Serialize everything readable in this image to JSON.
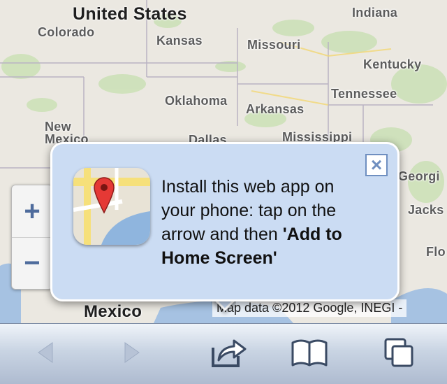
{
  "map": {
    "labels": {
      "united_states": "United States",
      "colorado": "Colorado",
      "kansas": "Kansas",
      "missouri": "Missouri",
      "indiana": "Indiana",
      "kentucky": "Kentucky",
      "tennessee": "Tennessee",
      "oklahoma": "Oklahoma",
      "arkansas": "Arkansas",
      "new_mexico": "New\nMexico",
      "dallas": "Dallas",
      "mississippi": "Mississippi",
      "georgia": "Georgi",
      "jacks": "Jacks",
      "flo": "Flo",
      "mexico": "Mexico"
    },
    "attribution": "Map data ©2012 Google, INEGI -",
    "zoom": {
      "in_label": "+",
      "out_label": "−"
    }
  },
  "popup": {
    "text_plain": "Install this web app on your phone: tap on the arrow and then ",
    "text_bold": "'Add to Home Screen'",
    "close_label": "×"
  },
  "toolbar": {
    "buttons": [
      "back-arrow-icon",
      "forward-arrow-icon",
      "share-icon",
      "bookmarks-book-icon",
      "pages-tabs-icon"
    ]
  },
  "colors": {
    "popup_bg": "#cbdcf3",
    "accent": "#4e6b9c",
    "toolbar_top": "#f0f4f9",
    "toolbar_bottom": "#aebbd0"
  }
}
